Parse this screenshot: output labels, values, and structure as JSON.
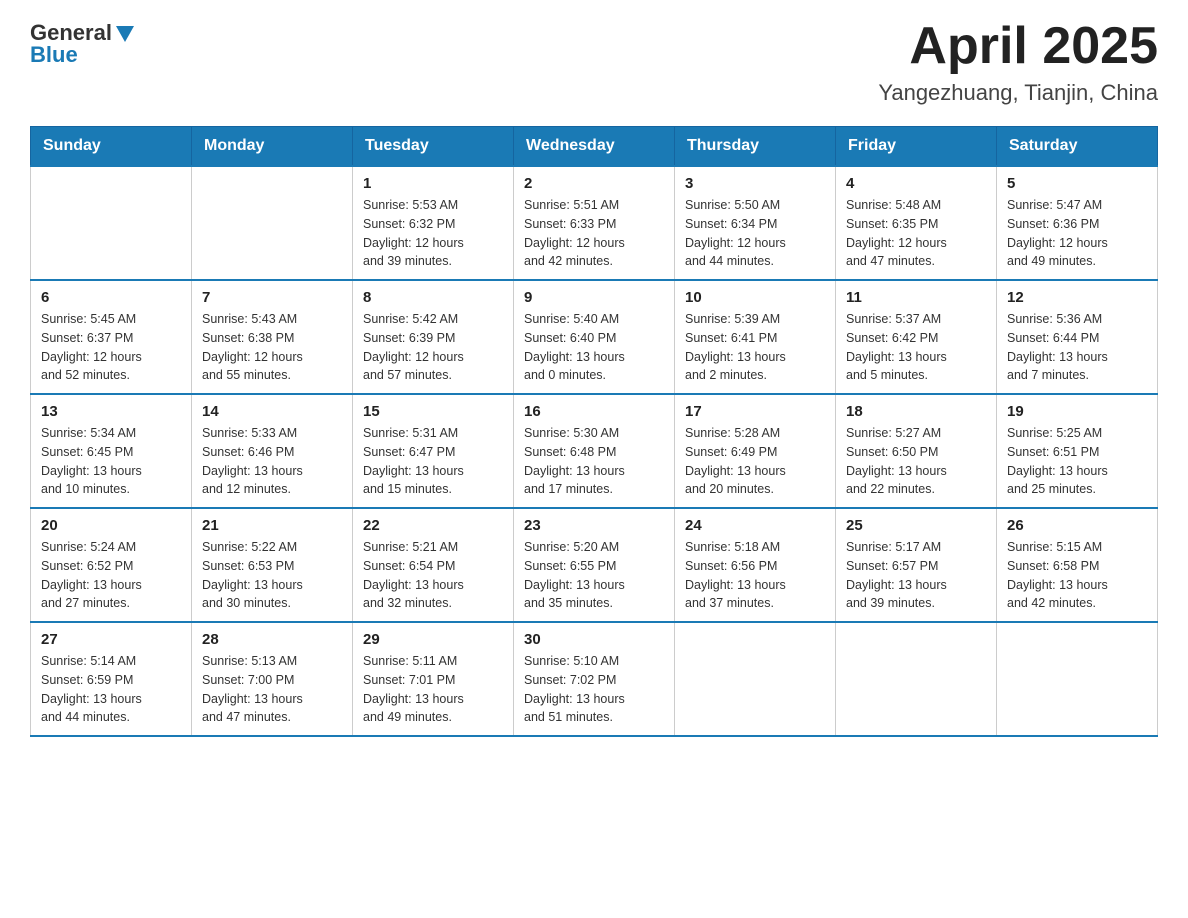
{
  "logo": {
    "general": "General",
    "blue": "Blue"
  },
  "title": "April 2025",
  "location": "Yangezhuang, Tianjin, China",
  "weekdays": [
    "Sunday",
    "Monday",
    "Tuesday",
    "Wednesday",
    "Thursday",
    "Friday",
    "Saturday"
  ],
  "weeks": [
    [
      {
        "day": "",
        "info": ""
      },
      {
        "day": "",
        "info": ""
      },
      {
        "day": "1",
        "info": "Sunrise: 5:53 AM\nSunset: 6:32 PM\nDaylight: 12 hours\nand 39 minutes."
      },
      {
        "day": "2",
        "info": "Sunrise: 5:51 AM\nSunset: 6:33 PM\nDaylight: 12 hours\nand 42 minutes."
      },
      {
        "day": "3",
        "info": "Sunrise: 5:50 AM\nSunset: 6:34 PM\nDaylight: 12 hours\nand 44 minutes."
      },
      {
        "day": "4",
        "info": "Sunrise: 5:48 AM\nSunset: 6:35 PM\nDaylight: 12 hours\nand 47 minutes."
      },
      {
        "day": "5",
        "info": "Sunrise: 5:47 AM\nSunset: 6:36 PM\nDaylight: 12 hours\nand 49 minutes."
      }
    ],
    [
      {
        "day": "6",
        "info": "Sunrise: 5:45 AM\nSunset: 6:37 PM\nDaylight: 12 hours\nand 52 minutes."
      },
      {
        "day": "7",
        "info": "Sunrise: 5:43 AM\nSunset: 6:38 PM\nDaylight: 12 hours\nand 55 minutes."
      },
      {
        "day": "8",
        "info": "Sunrise: 5:42 AM\nSunset: 6:39 PM\nDaylight: 12 hours\nand 57 minutes."
      },
      {
        "day": "9",
        "info": "Sunrise: 5:40 AM\nSunset: 6:40 PM\nDaylight: 13 hours\nand 0 minutes."
      },
      {
        "day": "10",
        "info": "Sunrise: 5:39 AM\nSunset: 6:41 PM\nDaylight: 13 hours\nand 2 minutes."
      },
      {
        "day": "11",
        "info": "Sunrise: 5:37 AM\nSunset: 6:42 PM\nDaylight: 13 hours\nand 5 minutes."
      },
      {
        "day": "12",
        "info": "Sunrise: 5:36 AM\nSunset: 6:44 PM\nDaylight: 13 hours\nand 7 minutes."
      }
    ],
    [
      {
        "day": "13",
        "info": "Sunrise: 5:34 AM\nSunset: 6:45 PM\nDaylight: 13 hours\nand 10 minutes."
      },
      {
        "day": "14",
        "info": "Sunrise: 5:33 AM\nSunset: 6:46 PM\nDaylight: 13 hours\nand 12 minutes."
      },
      {
        "day": "15",
        "info": "Sunrise: 5:31 AM\nSunset: 6:47 PM\nDaylight: 13 hours\nand 15 minutes."
      },
      {
        "day": "16",
        "info": "Sunrise: 5:30 AM\nSunset: 6:48 PM\nDaylight: 13 hours\nand 17 minutes."
      },
      {
        "day": "17",
        "info": "Sunrise: 5:28 AM\nSunset: 6:49 PM\nDaylight: 13 hours\nand 20 minutes."
      },
      {
        "day": "18",
        "info": "Sunrise: 5:27 AM\nSunset: 6:50 PM\nDaylight: 13 hours\nand 22 minutes."
      },
      {
        "day": "19",
        "info": "Sunrise: 5:25 AM\nSunset: 6:51 PM\nDaylight: 13 hours\nand 25 minutes."
      }
    ],
    [
      {
        "day": "20",
        "info": "Sunrise: 5:24 AM\nSunset: 6:52 PM\nDaylight: 13 hours\nand 27 minutes."
      },
      {
        "day": "21",
        "info": "Sunrise: 5:22 AM\nSunset: 6:53 PM\nDaylight: 13 hours\nand 30 minutes."
      },
      {
        "day": "22",
        "info": "Sunrise: 5:21 AM\nSunset: 6:54 PM\nDaylight: 13 hours\nand 32 minutes."
      },
      {
        "day": "23",
        "info": "Sunrise: 5:20 AM\nSunset: 6:55 PM\nDaylight: 13 hours\nand 35 minutes."
      },
      {
        "day": "24",
        "info": "Sunrise: 5:18 AM\nSunset: 6:56 PM\nDaylight: 13 hours\nand 37 minutes."
      },
      {
        "day": "25",
        "info": "Sunrise: 5:17 AM\nSunset: 6:57 PM\nDaylight: 13 hours\nand 39 minutes."
      },
      {
        "day": "26",
        "info": "Sunrise: 5:15 AM\nSunset: 6:58 PM\nDaylight: 13 hours\nand 42 minutes."
      }
    ],
    [
      {
        "day": "27",
        "info": "Sunrise: 5:14 AM\nSunset: 6:59 PM\nDaylight: 13 hours\nand 44 minutes."
      },
      {
        "day": "28",
        "info": "Sunrise: 5:13 AM\nSunset: 7:00 PM\nDaylight: 13 hours\nand 47 minutes."
      },
      {
        "day": "29",
        "info": "Sunrise: 5:11 AM\nSunset: 7:01 PM\nDaylight: 13 hours\nand 49 minutes."
      },
      {
        "day": "30",
        "info": "Sunrise: 5:10 AM\nSunset: 7:02 PM\nDaylight: 13 hours\nand 51 minutes."
      },
      {
        "day": "",
        "info": ""
      },
      {
        "day": "",
        "info": ""
      },
      {
        "day": "",
        "info": ""
      }
    ]
  ]
}
